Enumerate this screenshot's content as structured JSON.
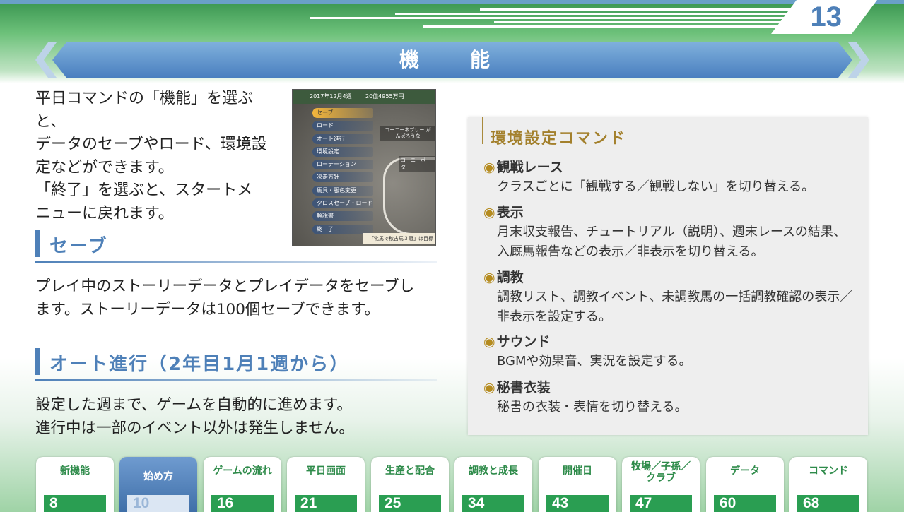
{
  "page_number": "13",
  "title": "機　能",
  "intro": {
    "lines": [
      "平日コマンドの「機能」を選ぶと、",
      "データのセーブやロード、環境設",
      "定などができます。",
      "「終了」を選ぶと、スタートメ",
      "ニューに戻れます。"
    ]
  },
  "screenshot": {
    "date": "2017年12月4週",
    "money": "20億4955万円",
    "menu": [
      "セーブ",
      "ロード",
      "オート進行",
      "環境設定",
      "ローテーション",
      "次走方針",
      "馬具・服色変更",
      "クロスセーブ・ロード",
      "解説書",
      "終　了"
    ],
    "course_label": "コーニーネブリー がんばろうな",
    "course_label2": "コーニーボーダ",
    "message": "「牝馬で秋古馬３冠」は目標"
  },
  "sections": {
    "save": {
      "heading": "セーブ",
      "lines": [
        "プレイ中のストーリーデータとプレイデータをセーブし",
        "ます。ストーリーデータは100個セーブできます。"
      ]
    },
    "auto": {
      "heading": "オート進行（2年目1月1週から）",
      "lines": [
        "設定した週まで、ゲームを自動的に進めます。",
        "進行中は一部のイベント以外は発生しません。"
      ]
    }
  },
  "panel": {
    "title": "環境設定コマンド",
    "bullet": "◉",
    "commands": [
      {
        "name": "観戦レース",
        "desc": [
          "クラスごとに「観戦する／観戦しない」を切り替える。"
        ]
      },
      {
        "name": "表示",
        "desc": [
          "月末収支報告、チュートリアル（説明）、週末レースの結果、",
          "入厩馬報告などの表示／非表示を切り替える。"
        ]
      },
      {
        "name": "調教",
        "desc": [
          "調教リスト、調教イベント、未調教馬の一括調教確認の表示／",
          "非表示を設定する。"
        ]
      },
      {
        "name": "サウンド",
        "desc": [
          "BGMや効果音、実況を設定する。"
        ]
      },
      {
        "name": "秘書衣装",
        "desc": [
          "秘書の衣装・表情を切り替える。"
        ]
      }
    ]
  },
  "nav": [
    {
      "label": "新機能",
      "page": "8"
    },
    {
      "label": "始め方",
      "page": "10",
      "active": true
    },
    {
      "label": "ゲームの流れ",
      "page": "16"
    },
    {
      "label": "平日画面",
      "page": "21"
    },
    {
      "label": "生産と配合",
      "page": "25"
    },
    {
      "label": "調教と成長",
      "page": "34"
    },
    {
      "label": "開催日",
      "page": "43"
    },
    {
      "label": "牧場／子孫／クラブ",
      "label_lines": [
        "牧場／子孫／",
        "クラブ"
      ],
      "page": "47"
    },
    {
      "label": "データ",
      "page": "60"
    },
    {
      "label": "コマンド",
      "page": "68"
    }
  ],
  "colors": {
    "accent_blue": "#4e80b8",
    "nav_green": "#2a9e52",
    "panel_gold": "#a3802c"
  }
}
